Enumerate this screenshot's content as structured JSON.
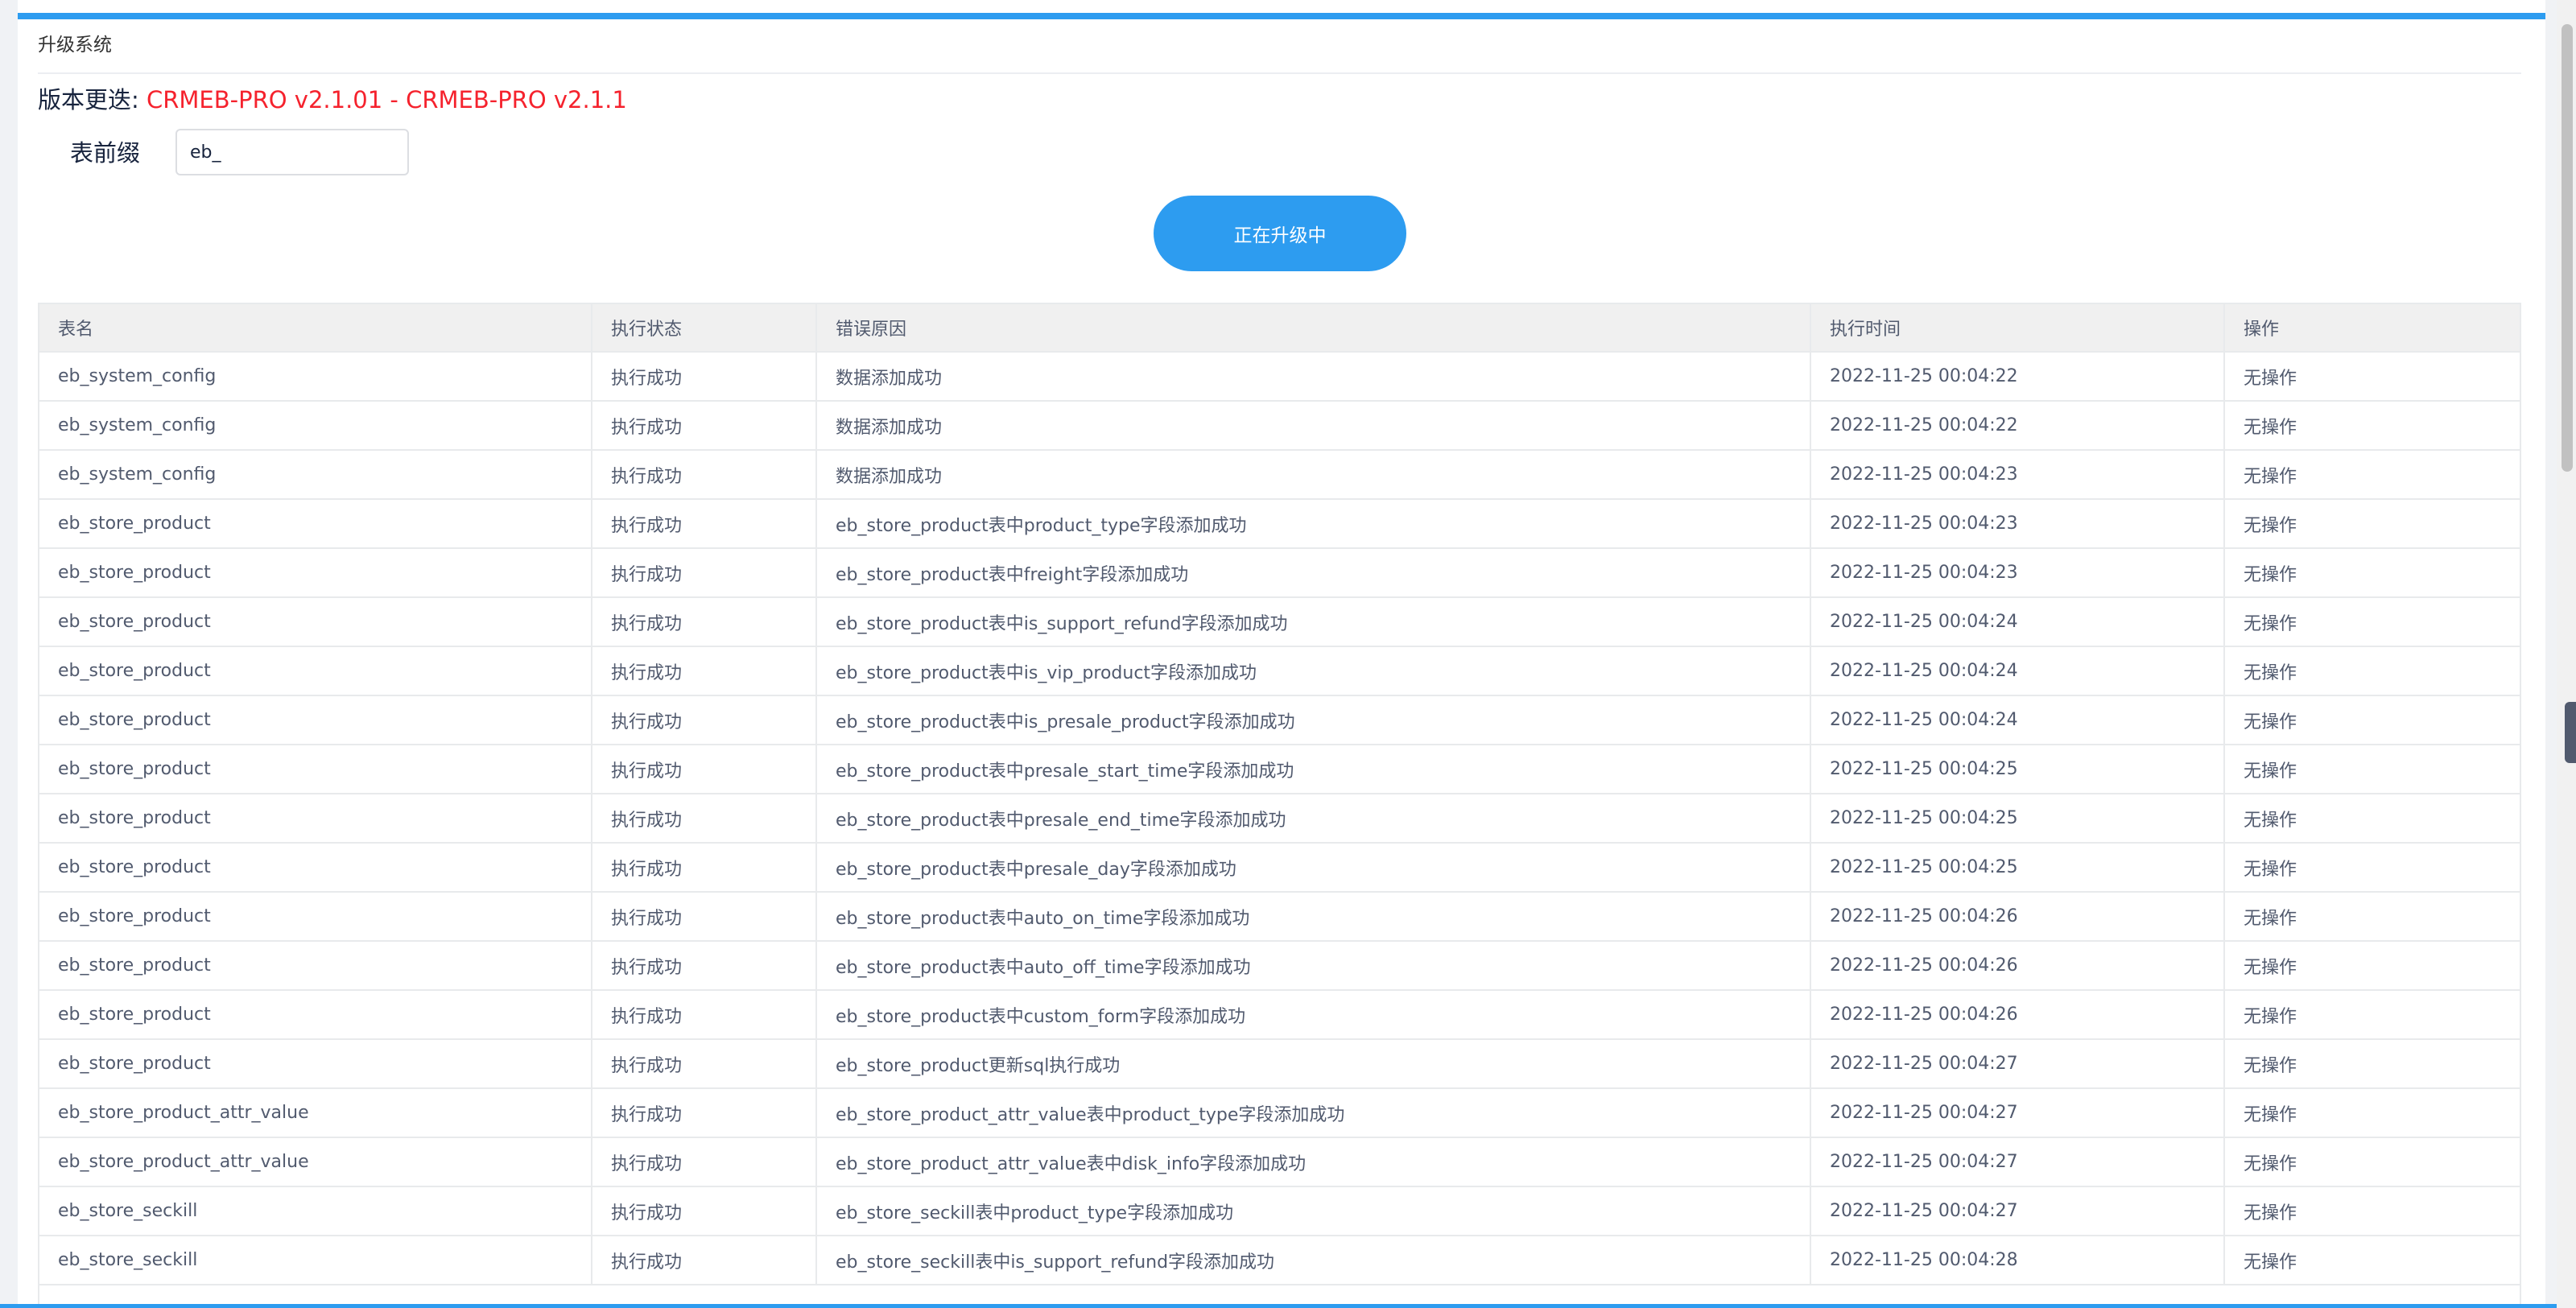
{
  "panel": {
    "title": "升级系统"
  },
  "version": {
    "label": "版本更迭:",
    "value": "CRMEB-PRO v2.1.01 - CRMEB-PRO v2.1.1"
  },
  "prefix": {
    "label": "表前缀",
    "value": "eb_"
  },
  "upgrade_button": {
    "label": "正在升级中"
  },
  "colors": {
    "accent": "#2d9cf0",
    "version_red": "#f5222d",
    "header_bg": "#f0f0f0"
  },
  "table": {
    "headers": [
      "表名",
      "执行状态",
      "错误原因",
      "执行时间",
      "操作"
    ],
    "rows": [
      [
        "eb_system_config",
        "执行成功",
        "数据添加成功",
        "2022-11-25 00:04:22",
        "无操作"
      ],
      [
        "eb_system_config",
        "执行成功",
        "数据添加成功",
        "2022-11-25 00:04:22",
        "无操作"
      ],
      [
        "eb_system_config",
        "执行成功",
        "数据添加成功",
        "2022-11-25 00:04:23",
        "无操作"
      ],
      [
        "eb_store_product",
        "执行成功",
        "eb_store_product表中product_type字段添加成功",
        "2022-11-25 00:04:23",
        "无操作"
      ],
      [
        "eb_store_product",
        "执行成功",
        "eb_store_product表中freight字段添加成功",
        "2022-11-25 00:04:23",
        "无操作"
      ],
      [
        "eb_store_product",
        "执行成功",
        "eb_store_product表中is_support_refund字段添加成功",
        "2022-11-25 00:04:24",
        "无操作"
      ],
      [
        "eb_store_product",
        "执行成功",
        "eb_store_product表中is_vip_product字段添加成功",
        "2022-11-25 00:04:24",
        "无操作"
      ],
      [
        "eb_store_product",
        "执行成功",
        "eb_store_product表中is_presale_product字段添加成功",
        "2022-11-25 00:04:24",
        "无操作"
      ],
      [
        "eb_store_product",
        "执行成功",
        "eb_store_product表中presale_start_time字段添加成功",
        "2022-11-25 00:04:25",
        "无操作"
      ],
      [
        "eb_store_product",
        "执行成功",
        "eb_store_product表中presale_end_time字段添加成功",
        "2022-11-25 00:04:25",
        "无操作"
      ],
      [
        "eb_store_product",
        "执行成功",
        "eb_store_product表中presale_day字段添加成功",
        "2022-11-25 00:04:25",
        "无操作"
      ],
      [
        "eb_store_product",
        "执行成功",
        "eb_store_product表中auto_on_time字段添加成功",
        "2022-11-25 00:04:26",
        "无操作"
      ],
      [
        "eb_store_product",
        "执行成功",
        "eb_store_product表中auto_off_time字段添加成功",
        "2022-11-25 00:04:26",
        "无操作"
      ],
      [
        "eb_store_product",
        "执行成功",
        "eb_store_product表中custom_form字段添加成功",
        "2022-11-25 00:04:26",
        "无操作"
      ],
      [
        "eb_store_product",
        "执行成功",
        "eb_store_product更新sql执行成功",
        "2022-11-25 00:04:27",
        "无操作"
      ],
      [
        "eb_store_product_attr_value",
        "执行成功",
        "eb_store_product_attr_value表中product_type字段添加成功",
        "2022-11-25 00:04:27",
        "无操作"
      ],
      [
        "eb_store_product_attr_value",
        "执行成功",
        "eb_store_product_attr_value表中disk_info字段添加成功",
        "2022-11-25 00:04:27",
        "无操作"
      ],
      [
        "eb_store_seckill",
        "执行成功",
        "eb_store_seckill表中product_type字段添加成功",
        "2022-11-25 00:04:27",
        "无操作"
      ],
      [
        "eb_store_seckill",
        "执行成功",
        "eb_store_seckill表中is_support_refund字段添加成功",
        "2022-11-25 00:04:28",
        "无操作"
      ]
    ]
  }
}
